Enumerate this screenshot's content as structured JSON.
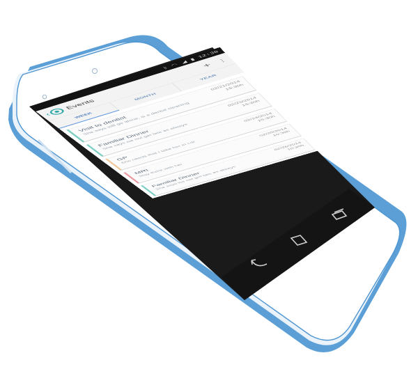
{
  "status_bar": {
    "bluetooth_icon": "bluetooth-icon",
    "wifi_icon": "wifi-icon",
    "signal_icon": "signal-icon",
    "battery_icon": "battery-icon",
    "time": "12:30"
  },
  "app_bar": {
    "title": "Events",
    "up_icon": "chevron-left-icon",
    "logo_icon": "app-logo-icon",
    "add_icon": "plus-icon",
    "add_glyph": "+",
    "more_icon": "more-vertical-icon",
    "more_glyph": "⋮"
  },
  "tabs": [
    {
      "label": "WEEK",
      "active": true
    },
    {
      "label": "MONTH",
      "active": false
    },
    {
      "label": "YEAR",
      "active": false
    }
  ],
  "events": [
    {
      "title": "Visit to dentist",
      "description": "She says will go alone, is a dental cleaning",
      "date": "02/21/2014",
      "time": "15:30h",
      "color": "#7fd0c4"
    },
    {
      "title": "Familiar Dinner",
      "description": "She says we not get late as always",
      "date": "02/23/2014",
      "time": "15:30h",
      "color": "#7fd0c4"
    },
    {
      "title": "GP",
      "description": "She needs that I take her in car",
      "date": "02/24/2014",
      "time": "15:30h",
      "color": "#f2c99a"
    },
    {
      "title": "MRI",
      "description": "Stay there with her",
      "date": "02/25/2014",
      "time": "10:30h",
      "color": "#ec9aa0"
    },
    {
      "title": "Familiar Dinner",
      "description": "She says we not get late as always",
      "date": "02/26/2014",
      "time": "10:30h",
      "color": "#7fd0c4"
    }
  ],
  "nav_bar": {
    "back_icon": "back-arrow-icon",
    "home_icon": "home-icon",
    "recents_icon": "recent-apps-icon"
  },
  "colors": {
    "accent": "#2aa7a6",
    "tab_active": "#6b9ee0",
    "device_outline": "#5b9fd6",
    "screen_bezel": "#1a1a1a"
  }
}
